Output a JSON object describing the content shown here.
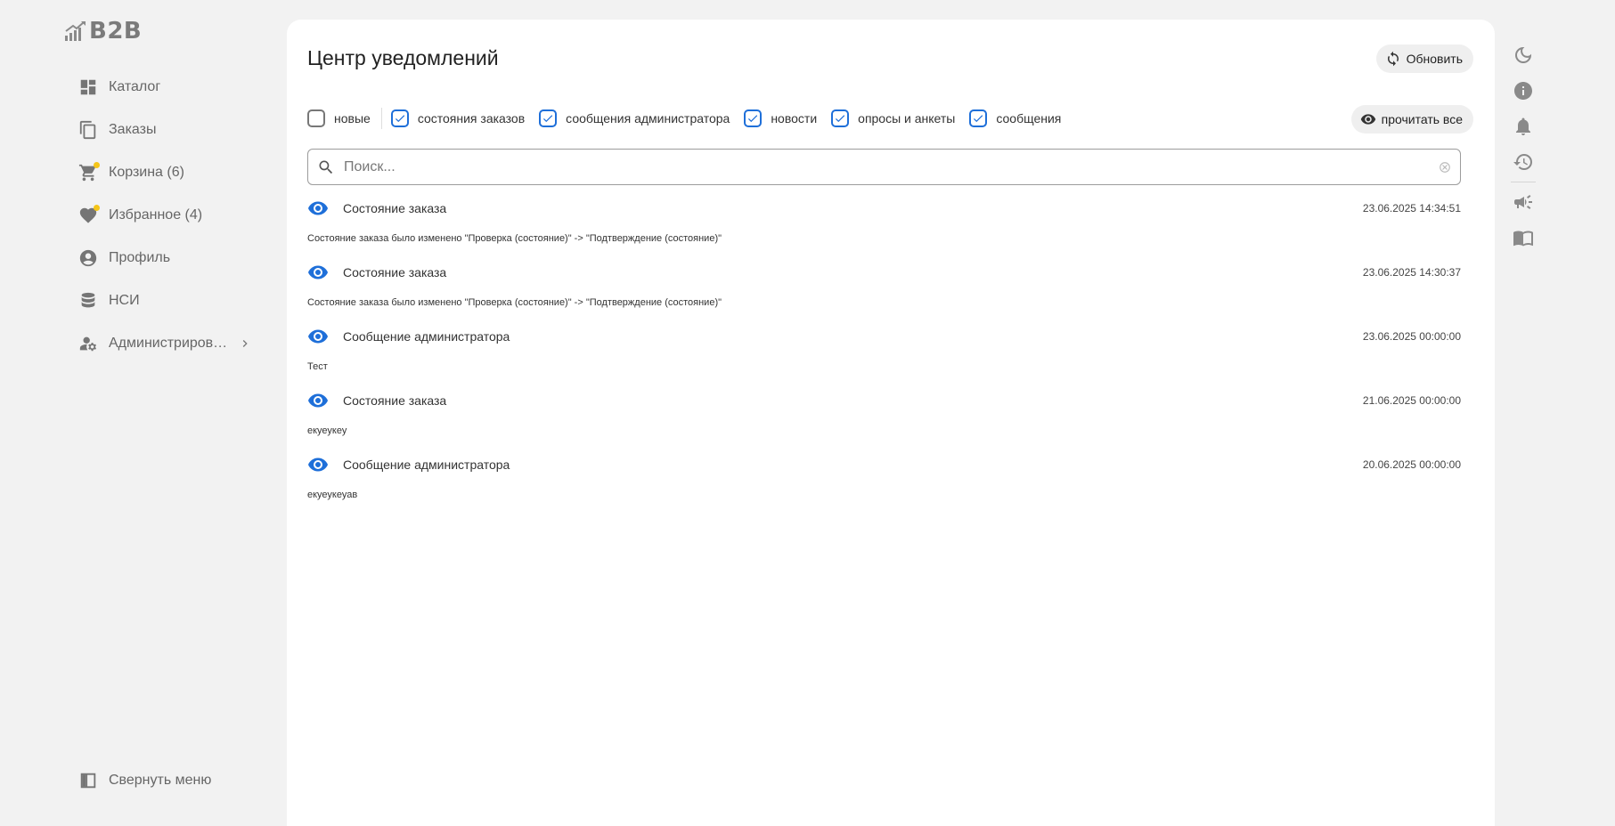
{
  "app": {
    "logo_text": "B2B"
  },
  "sidebar": {
    "items": [
      {
        "label": "Каталог",
        "icon": "dashboard-icon"
      },
      {
        "label": "Заказы",
        "icon": "copy-icon"
      },
      {
        "label": "Корзина (6)",
        "icon": "cart-icon",
        "dot": true
      },
      {
        "label": "Избранное (4)",
        "icon": "heart-icon",
        "dot": true
      },
      {
        "label": "Профиль",
        "icon": "account-icon"
      },
      {
        "label": "НСИ",
        "icon": "database-icon"
      },
      {
        "label": "Администриров…",
        "icon": "admin-icon",
        "chevron": true
      }
    ],
    "collapse_label": "Свернуть меню"
  },
  "main": {
    "title": "Центр уведомлений",
    "refresh_label": "Обновить",
    "read_all_label": "прочитать все",
    "filters": [
      {
        "label": "новые",
        "checked": false
      },
      {
        "label": "состояния заказов",
        "checked": true
      },
      {
        "label": "сообщения администратора",
        "checked": true
      },
      {
        "label": "новости",
        "checked": true
      },
      {
        "label": "опросы и анкеты",
        "checked": true
      },
      {
        "label": "сообщения",
        "checked": true
      }
    ],
    "search": {
      "placeholder": "Поиск...",
      "value": ""
    },
    "notifications": [
      {
        "title": "Состояние заказа",
        "time": "23.06.2025 14:34:51",
        "body": "Состояние заказа было изменено \"Проверка (состояние)\" -> \"Подтверждение (состояние)\""
      },
      {
        "title": "Состояние заказа",
        "time": "23.06.2025 14:30:37",
        "body": "Состояние заказа было изменено \"Проверка (состояние)\" -> \"Подтверждение (состояние)\""
      },
      {
        "title": "Сообщение администратора",
        "time": "23.06.2025 00:00:00",
        "body": "Тест"
      },
      {
        "title": "Состояние заказа",
        "time": "21.06.2025 00:00:00",
        "body": "екуеукеу"
      },
      {
        "title": "Сообщение администратора",
        "time": "20.06.2025 00:00:00",
        "body": "екуеукеуав"
      }
    ]
  },
  "rail": {
    "icons": [
      "moon-icon",
      "info-icon",
      "bell-icon",
      "history-icon",
      "megaphone-icon",
      "book-icon"
    ]
  },
  "colors": {
    "accent": "#1e6fd9",
    "badge_dot": "#f5c518",
    "background": "#f2f2f2"
  }
}
